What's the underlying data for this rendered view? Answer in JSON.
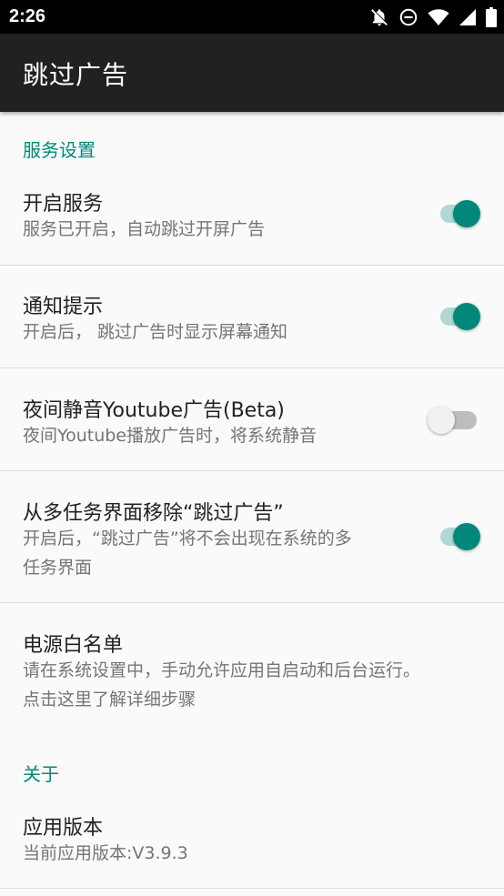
{
  "status_bar": {
    "time": "2:26",
    "icons": [
      "notifications-off-icon",
      "do-not-disturb-icon",
      "wifi-icon",
      "signal-icon",
      "battery-icon"
    ]
  },
  "app_bar": {
    "title": "跳过广告"
  },
  "sections": {
    "service_settings": "服务设置",
    "about": "关于"
  },
  "preferences": {
    "enable_service": {
      "title": "开启服务",
      "summary": "服务已开启，自动跳过开屏广告",
      "checked": true
    },
    "notification": {
      "title": "通知提示",
      "summary": "开启后， 跳过广告时显示屏幕通知",
      "checked": true
    },
    "night_mute": {
      "title": "夜间静音Youtube广告(Beta)",
      "summary": "夜间Youtube播放广告时，将系统静音",
      "checked": false
    },
    "hide_recents": {
      "title": "从多任务界面移除“跳过广告”",
      "summary_line1": "开启后，“跳过广告”将不会出现在系统的多",
      "summary_line2": "任务界面",
      "checked": true
    },
    "power_whitelist": {
      "title": "电源白名单",
      "summary_line1": "请在系统设置中，手动允许应用自启动和后台运行。",
      "summary_line2": "点击这里了解详细步骤"
    },
    "app_version": {
      "title": "应用版本",
      "summary": "当前应用版本:V3.9.3"
    }
  },
  "colors": {
    "accent": "#00897b",
    "toolbar": "#212121",
    "background": "#fafafa"
  }
}
